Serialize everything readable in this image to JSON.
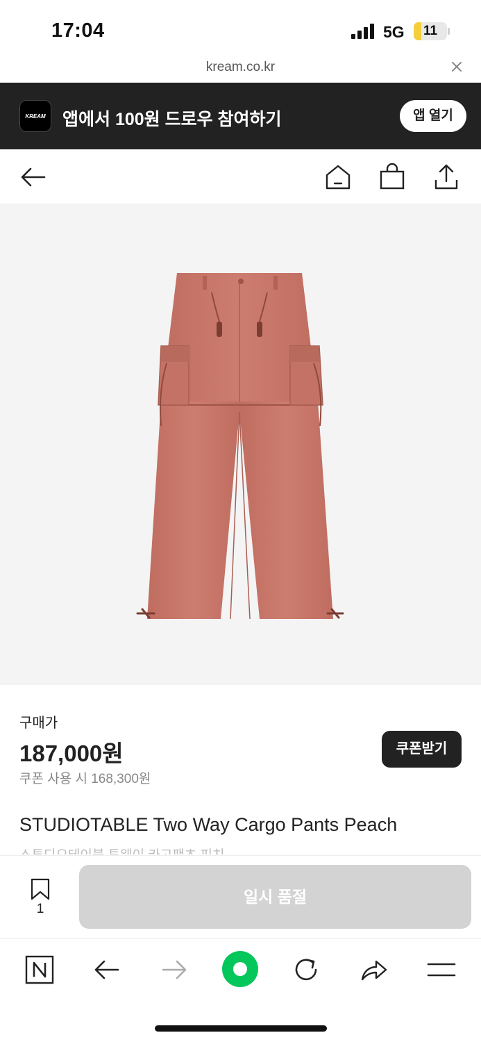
{
  "status_bar": {
    "time": "17:04",
    "network": "5G",
    "battery": "11",
    "battery_level": 0.11
  },
  "browser": {
    "url": "kream.co.kr"
  },
  "app_banner": {
    "logo_text": "KREAM",
    "message": "앱에서 100원 드로우 참여하기",
    "open_label": "앱 열기"
  },
  "nav": {
    "icons": [
      "back-arrow-icon",
      "home-icon",
      "shopping-bag-icon",
      "share-icon"
    ]
  },
  "product": {
    "price_label": "구매가",
    "price": "187,000원",
    "coupon_price": "쿠폰 사용 시 168,300원",
    "coupon_button": "쿠폰받기",
    "title_en": "STUDIOTABLE Two Way Cargo Pants Peach",
    "title_ko": "스튜디오테이블 투웨이 카고팬츠 피치",
    "image_color": "#c9786a"
  },
  "actions": {
    "bookmark_count": "1",
    "primary_button": "일시 품절"
  },
  "browser_toolbar": {
    "icons": [
      "naver-n-icon",
      "back-icon",
      "forward-icon",
      "green-dot-icon",
      "refresh-icon",
      "share-icon",
      "menu-icon"
    ]
  },
  "colors": {
    "banner_bg": "#222222",
    "accent_green": "#03c75a",
    "soldout_bg": "#d3d3d3"
  }
}
